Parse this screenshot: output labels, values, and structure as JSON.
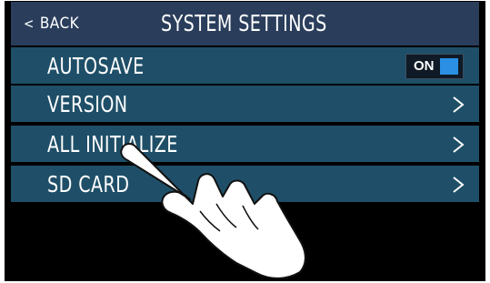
{
  "header": {
    "back_label": "BACK",
    "title": "SYSTEM SETTINGS"
  },
  "menu": {
    "items": [
      {
        "label": "AUTOSAVE",
        "control": "toggle"
      },
      {
        "label": "VERSION",
        "control": "chevron-right-icon"
      },
      {
        "label": "ALL INITIALIZE",
        "control": "chevron-right-icon"
      },
      {
        "label": "SD CARD",
        "control": "chevron-right-icon"
      }
    ],
    "autosave_toggle": {
      "label": "ON",
      "state": "on",
      "accent_color": "#2b8fe3"
    }
  },
  "colors": {
    "header_bg": "#2a3e5c",
    "row_bg": "#1f4f68",
    "screen_bg": "#000000"
  },
  "overlay": {
    "icon": "pointing-hand-icon"
  }
}
